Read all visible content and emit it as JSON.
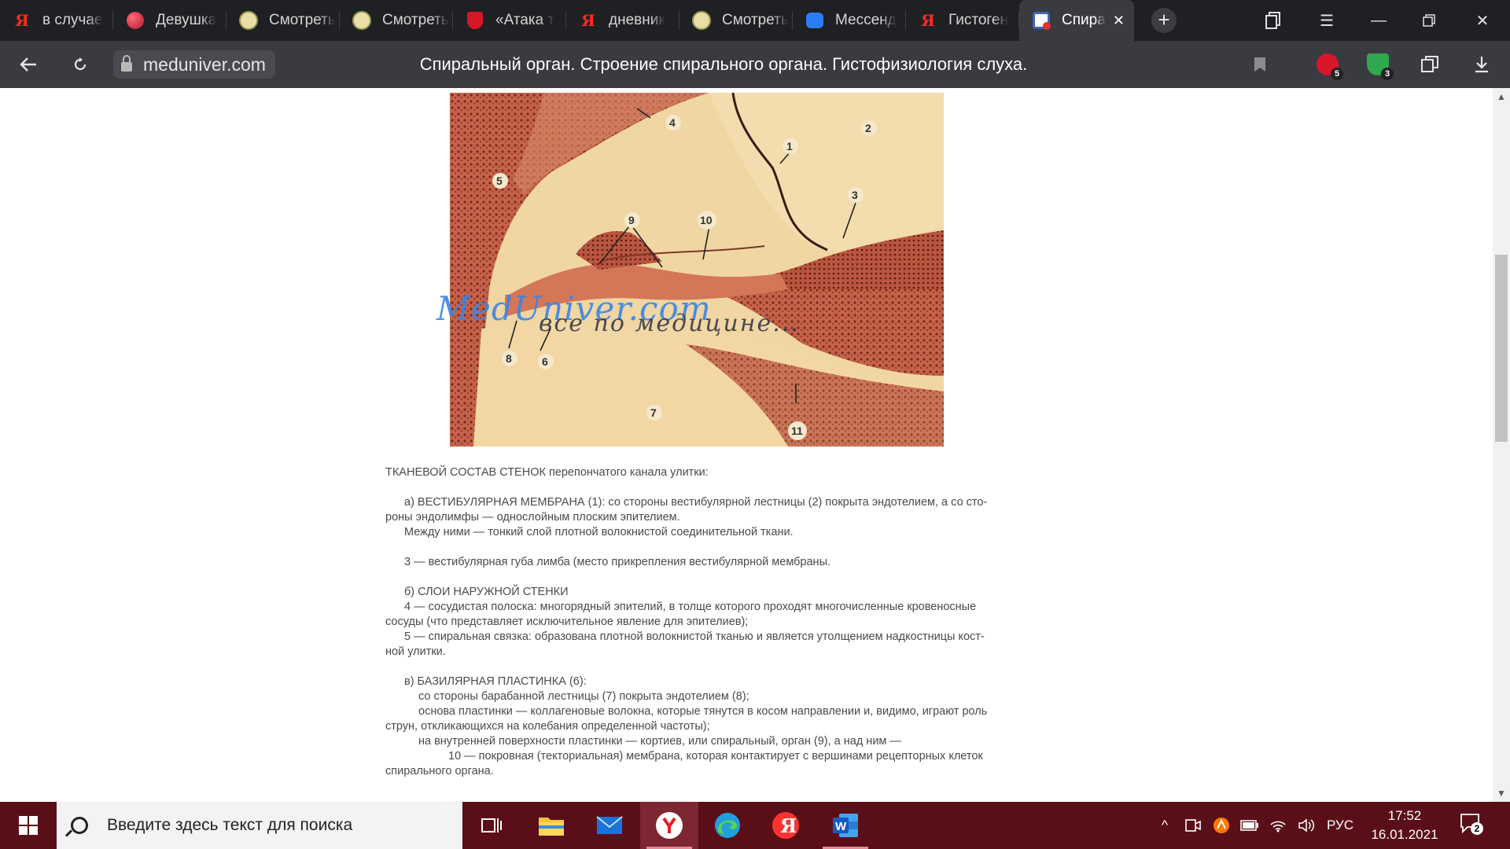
{
  "tabs": [
    {
      "label": "в случае",
      "icon": "yandex-icon"
    },
    {
      "label": "Девушка",
      "icon": "berry-icon"
    },
    {
      "label": "Смотреть",
      "icon": "leaf-icon"
    },
    {
      "label": "Смотреть",
      "icon": "leaf-icon"
    },
    {
      "label": "«Атака т",
      "icon": "shield-icon"
    },
    {
      "label": "дневник",
      "icon": "yandex-icon"
    },
    {
      "label": "Смотреть",
      "icon": "leaf-icon"
    },
    {
      "label": "Мессенд",
      "icon": "messenger-icon"
    },
    {
      "label": "Гистоген",
      "icon": "yandex-icon"
    },
    {
      "label": "Спира",
      "icon": "calendar-icon",
      "active": true
    }
  ],
  "toolbar": {
    "domain": "meduniver.com",
    "page_title": "Спиральный орган. Строение спирального органа. Гистофизиология слуха.",
    "ext1_badge": "5",
    "ext2_badge": "3"
  },
  "figure": {
    "labels": [
      "1",
      "2",
      "3",
      "4",
      "5",
      "6",
      "7",
      "8",
      "9",
      "10",
      "11"
    ],
    "watermark_main": "MedUniver.com",
    "watermark_sub": "все по медицине..."
  },
  "article": {
    "heading": "ТКАНЕВОЙ СОСТАВ СТЕНОК перепончатого канала улитки:",
    "a_1": "а) ВЕСТИБУЛЯРНАЯ МЕМБРАНА (1): со стороны вестибулярной лестницы (2) покрыта эндотелием, а  со сто-",
    "a_2": "роны эндолимфы — однослойным плоским эпителием.",
    "a_3": "Между ними — тонкий слой плотной волокнистой соединительной ткани.",
    "a_4": "3 — вестибулярная губа лимба (место прикрепления вестибулярной мембраны.",
    "b_1": "б) СЛОИ НАРУЖНОЙ СТЕНКИ",
    "b_2": "4 — сосудистая полоска: многорядный эпителий, в толще которого проходят многочисленные кровеносные",
    "b_3": "сосуды (что представляет исключительное явление для эпителиев);",
    "b_4": "5 — спиральная связка: образована плотной волокнистой тканью и является утолщением надкостницы кост-",
    "b_5": "ной улитки.",
    "c_1": "в) БАЗИЛЯРНАЯ ПЛАСТИНКА (6):",
    "c_2": "со стороны барабанной лестницы (7) покрыта эндотелием (8);",
    "c_3": "основа пластинки — коллагеновые волокна, которые тянутся в косом направлении и, видимо, играют роль",
    "c_4": "струн, откликающихся на колебания определенной частоты);",
    "c_5": "на внутренней поверхности пластинки —  кортиев, или спиральный, орган (9), а над ним —",
    "c_6": "10 — покровная (текториальная) мембрана, которая контактирует с вершинами рецепторных клеток",
    "c_7": "спирального органа."
  },
  "taskbar": {
    "search_placeholder": "Введите здесь текст для поиска",
    "language": "РУС",
    "time": "17:52",
    "date": "16.01.2021",
    "notifications": "2"
  },
  "colors": {
    "tabstrip": "#1f2023",
    "toolbar": "#3a3b40",
    "taskbar": "#5a0f18"
  }
}
